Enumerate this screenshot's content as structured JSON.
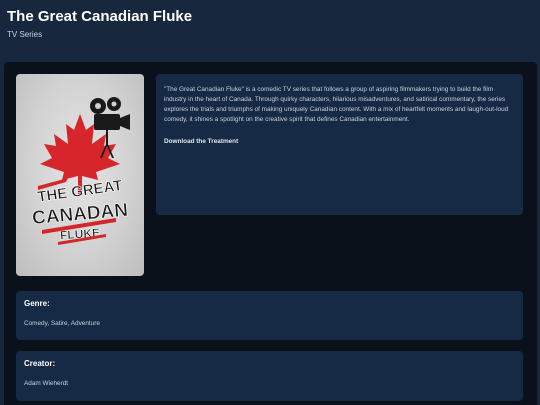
{
  "header": {
    "title": "The Great Canadian Fluke",
    "subtitle": "TV Series"
  },
  "poster": {
    "logo_lines": [
      "THE GREAT",
      "CANADAN",
      "FLUKE"
    ],
    "colors": {
      "red": "#d6262b",
      "dark": "#1a1a1a"
    }
  },
  "description": {
    "text": "\"The Great Canadian Fluke\" is a comedic TV series that follows a group of aspiring filmmakers trying to build the film industry in the heart of Canada. Through quirky characters, hilarious misadventures, and satirical commentary, the series explores the trials and triumphs of making uniquely Canadian content. With a mix of heartfelt moments and laugh-out-loud comedy, it shines a spotlight on the creative spirit that defines Canadian entertainment.",
    "download_label": "Download the Treatment"
  },
  "genre": {
    "heading": "Genre:",
    "value": "Comedy, Satire, Adventure"
  },
  "creator": {
    "heading": "Creator:",
    "value": "Adam Wieherdt"
  },
  "colors": {
    "page_bg": "#17283e",
    "content_bg": "#0a111b",
    "card_bg": "#172a45"
  }
}
